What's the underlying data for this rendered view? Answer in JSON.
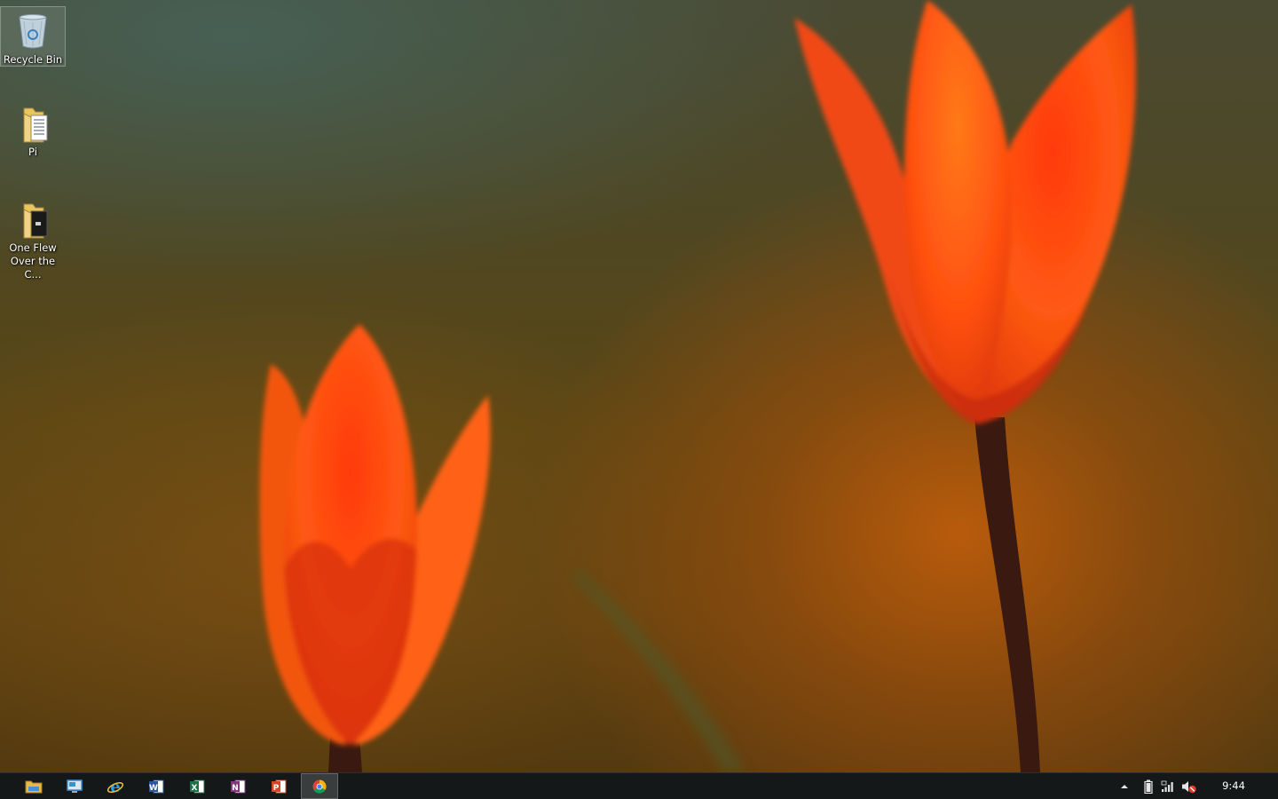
{
  "desktop": {
    "icons": [
      {
        "name": "recycle-bin",
        "label": "Recycle Bin",
        "icon": "recycle-bin-icon",
        "selected": true
      },
      {
        "name": "pi-folder",
        "label": "Pi",
        "icon": "folder-icon",
        "selected": false
      },
      {
        "name": "one-flew-folder",
        "label": "One Flew Over the C...",
        "icon": "folder-icon",
        "selected": false
      }
    ],
    "wallpaper": "orange-tulips"
  },
  "taskbar": {
    "background": "#151819",
    "pinned": [
      {
        "name": "file-explorer",
        "icon": "file-explorer-icon",
        "color": "#e8b84a"
      },
      {
        "name": "remote-desktop",
        "icon": "remote-desktop-icon",
        "color": "#3a8fd6"
      },
      {
        "name": "internet-explorer",
        "icon": "internet-explorer-icon",
        "color": "#2a9ee0"
      },
      {
        "name": "word",
        "icon": "word-icon",
        "letter": "W",
        "color": "#2b5797"
      },
      {
        "name": "excel",
        "icon": "excel-icon",
        "letter": "X",
        "color": "#1e7145"
      },
      {
        "name": "onenote",
        "icon": "onenote-icon",
        "letter": "N",
        "color": "#80397b"
      },
      {
        "name": "powerpoint",
        "icon": "powerpoint-icon",
        "letter": "P",
        "color": "#d24726"
      },
      {
        "name": "chrome",
        "icon": "chrome-icon",
        "active": true
      }
    ],
    "tray": [
      {
        "name": "show-hidden-icons",
        "icon": "chevron-up-icon"
      },
      {
        "name": "battery",
        "icon": "battery-icon"
      },
      {
        "name": "network",
        "icon": "network-icon"
      },
      {
        "name": "volume",
        "icon": "volume-muted-icon"
      }
    ],
    "clock": "9:44"
  }
}
